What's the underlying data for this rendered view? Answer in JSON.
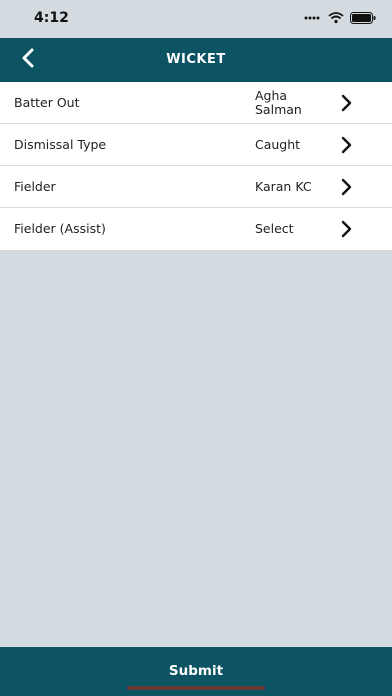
{
  "status_bar": {
    "time": "4:12"
  },
  "header": {
    "title": "WICKET",
    "back_icon": "chevron-left-icon"
  },
  "rows": [
    {
      "label": "Batter Out",
      "value": "Agha Salman"
    },
    {
      "label": "Dismissal Type",
      "value": "Caught"
    },
    {
      "label": "Fielder",
      "value": "Karan KC"
    },
    {
      "label": "Fielder (Assist)",
      "value": "Select"
    }
  ],
  "submit": {
    "label": "Submit"
  },
  "colors": {
    "brand": "#0c5363",
    "background": "#d3dae0",
    "row_bg": "#ffffff"
  }
}
